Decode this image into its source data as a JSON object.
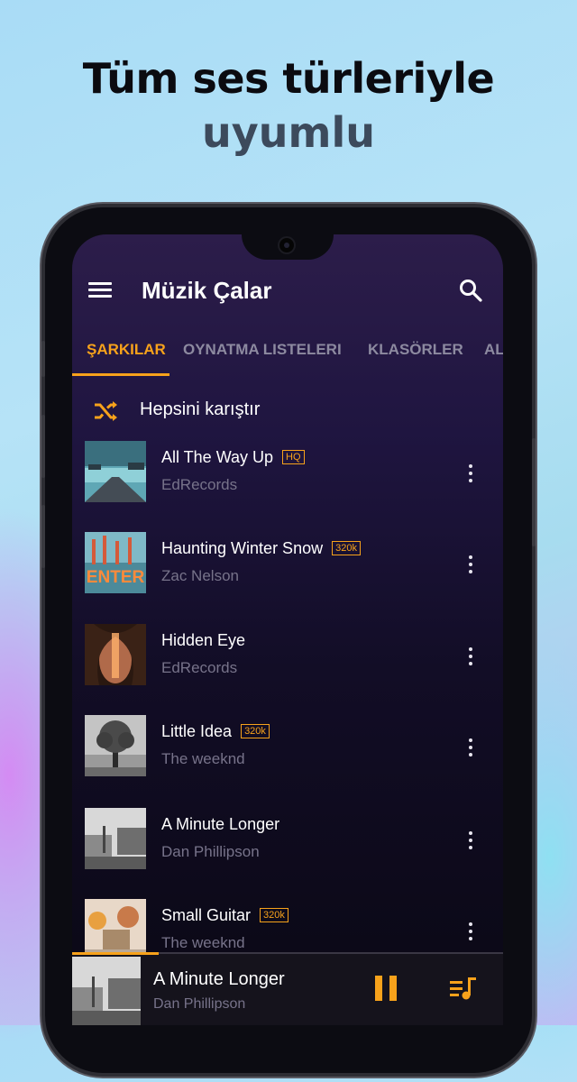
{
  "headline": {
    "line1": "Tüm ses türleriyle",
    "line2": "uyumlu"
  },
  "app": {
    "title": "Müzik Çalar",
    "menu_icon": "hamburger-menu-icon",
    "search_icon": "search-icon"
  },
  "tabs": [
    {
      "label": "ŞARKILAR",
      "active": true
    },
    {
      "label": "OYNATMA LISTELERI",
      "active": false
    },
    {
      "label": "KLASÖRLER",
      "active": false
    },
    {
      "label": "AL",
      "active": false
    }
  ],
  "shuffle": {
    "label": "Hepsini karıştır",
    "icon": "shuffle-icon"
  },
  "songs": [
    {
      "title": "All The Way Up",
      "badge": "HQ",
      "artist": "EdRecords"
    },
    {
      "title": "Haunting Winter Snow",
      "badge": "320k",
      "artist": "Zac Nelson",
      "cover_text": "ENTER"
    },
    {
      "title": "Hidden Eye",
      "badge": "",
      "artist": "EdRecords"
    },
    {
      "title": "Little Idea",
      "badge": "320k",
      "artist": "The weeknd"
    },
    {
      "title": "A Minute Longer",
      "badge": "",
      "artist": "Dan Phillipson"
    },
    {
      "title": "Small Guitar",
      "badge": "320k",
      "artist": "The weeknd"
    }
  ],
  "now_playing": {
    "title": "A Minute Longer",
    "artist": "Dan Phillipson",
    "progress": 0.2,
    "state": "playing",
    "pause_icon": "pause-icon",
    "queue_icon": "playlist-queue-icon"
  },
  "colors": {
    "accent": "#f7a21b",
    "text_primary": "#ffffff",
    "text_secondary": "#77738a"
  }
}
